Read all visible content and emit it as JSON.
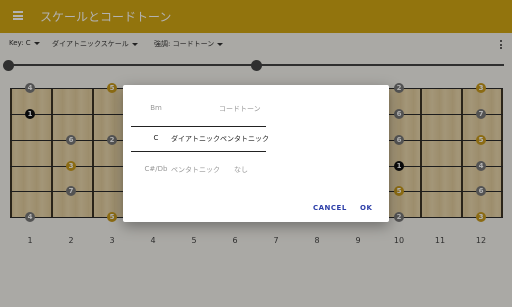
{
  "app_bar": {
    "title": "スケールとコードトーン",
    "menu_icon": "hamburger-menu-icon",
    "background": "#d2a614"
  },
  "toolbar": {
    "key_label": "Key: C",
    "scale_label": "ダイアトニックスケール",
    "emphasis_label": "強調: コードトーン",
    "more_icon": "more-vert-icon"
  },
  "fretboard": {
    "fret_numbers": [
      "1",
      "2",
      "3",
      "4",
      "5",
      "6",
      "7",
      "8",
      "9",
      "10",
      "11",
      "12"
    ],
    "dot_colors": {
      "root": "#111111",
      "chord": "#c89a1c",
      "scale": "#777777"
    },
    "visible_degree_labels": [
      "4",
      "5",
      "1",
      "6",
      "2",
      "3",
      "7",
      "5",
      "4",
      "7",
      "2",
      "6",
      "3",
      "5",
      "1",
      "4"
    ]
  },
  "dialog": {
    "rows": [
      {
        "chord": "Bm",
        "scale": "コードトーン"
      },
      {
        "chord": "C",
        "scale": "ダイアトニックペンタトニック"
      },
      {
        "chord": "C#/Db",
        "scale": "ペンタトニック",
        "extra": "なし"
      }
    ],
    "cancel_label": "CANCEL",
    "ok_label": "OK",
    "accent": "#2c3ea8"
  }
}
